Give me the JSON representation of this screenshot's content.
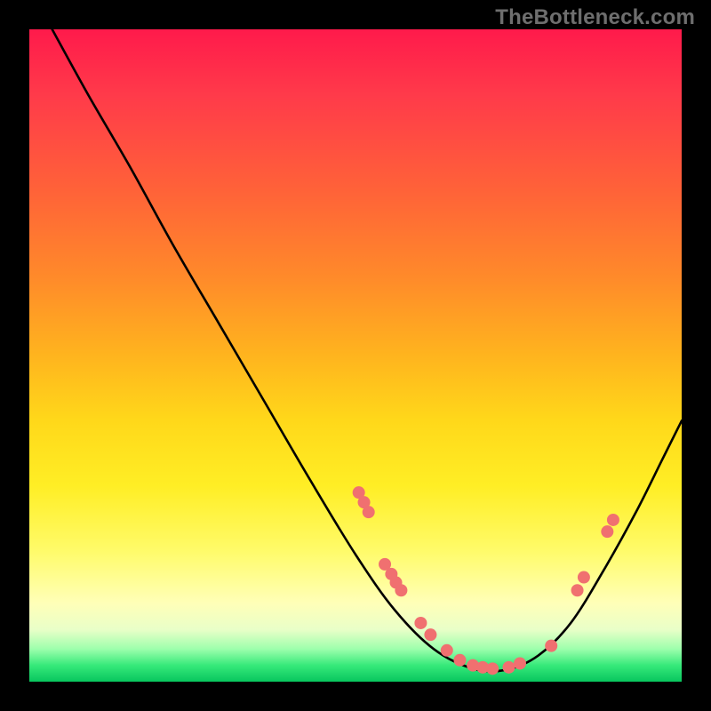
{
  "watermark": "TheBottleneck.com",
  "chart_data": {
    "type": "line",
    "title": "",
    "xlabel": "",
    "ylabel": "",
    "xlim": [
      0,
      1
    ],
    "ylim": [
      0,
      1
    ],
    "gradient_stops": [
      {
        "pos": 0.0,
        "color": "#ff1a4b"
      },
      {
        "pos": 0.1,
        "color": "#ff3a4a"
      },
      {
        "pos": 0.25,
        "color": "#ff6338"
      },
      {
        "pos": 0.38,
        "color": "#ff8a2a"
      },
      {
        "pos": 0.5,
        "color": "#ffb41e"
      },
      {
        "pos": 0.6,
        "color": "#ffd81a"
      },
      {
        "pos": 0.7,
        "color": "#ffee25"
      },
      {
        "pos": 0.8,
        "color": "#fffb6a"
      },
      {
        "pos": 0.88,
        "color": "#ffffb8"
      },
      {
        "pos": 0.92,
        "color": "#e9ffc8"
      },
      {
        "pos": 0.95,
        "color": "#9dffac"
      },
      {
        "pos": 0.975,
        "color": "#36e97a"
      },
      {
        "pos": 1.0,
        "color": "#08c65e"
      }
    ],
    "series": [
      {
        "name": "bottleneck-curve",
        "color": "#000000",
        "points": [
          {
            "x": 0.035,
            "y": 1.0
          },
          {
            "x": 0.09,
            "y": 0.9
          },
          {
            "x": 0.155,
            "y": 0.788
          },
          {
            "x": 0.22,
            "y": 0.67
          },
          {
            "x": 0.29,
            "y": 0.55
          },
          {
            "x": 0.36,
            "y": 0.43
          },
          {
            "x": 0.43,
            "y": 0.31
          },
          {
            "x": 0.5,
            "y": 0.195
          },
          {
            "x": 0.56,
            "y": 0.11
          },
          {
            "x": 0.62,
            "y": 0.05
          },
          {
            "x": 0.68,
            "y": 0.02
          },
          {
            "x": 0.73,
            "y": 0.018
          },
          {
            "x": 0.78,
            "y": 0.04
          },
          {
            "x": 0.83,
            "y": 0.09
          },
          {
            "x": 0.88,
            "y": 0.17
          },
          {
            "x": 0.93,
            "y": 0.26
          },
          {
            "x": 0.97,
            "y": 0.34
          },
          {
            "x": 1.0,
            "y": 0.4
          }
        ]
      }
    ],
    "markers": {
      "color": "#f07070",
      "radius_px": 7,
      "points": [
        {
          "x": 0.505,
          "y": 0.29
        },
        {
          "x": 0.513,
          "y": 0.275
        },
        {
          "x": 0.52,
          "y": 0.26
        },
        {
          "x": 0.545,
          "y": 0.18
        },
        {
          "x": 0.555,
          "y": 0.165
        },
        {
          "x": 0.562,
          "y": 0.152
        },
        {
          "x": 0.57,
          "y": 0.14
        },
        {
          "x": 0.6,
          "y": 0.09
        },
        {
          "x": 0.615,
          "y": 0.072
        },
        {
          "x": 0.64,
          "y": 0.048
        },
        {
          "x": 0.66,
          "y": 0.033
        },
        {
          "x": 0.68,
          "y": 0.025
        },
        {
          "x": 0.695,
          "y": 0.022
        },
        {
          "x": 0.71,
          "y": 0.02
        },
        {
          "x": 0.735,
          "y": 0.022
        },
        {
          "x": 0.752,
          "y": 0.028
        },
        {
          "x": 0.8,
          "y": 0.055
        },
        {
          "x": 0.84,
          "y": 0.14
        },
        {
          "x": 0.85,
          "y": 0.16
        },
        {
          "x": 0.886,
          "y": 0.23
        },
        {
          "x": 0.895,
          "y": 0.248
        }
      ]
    }
  }
}
